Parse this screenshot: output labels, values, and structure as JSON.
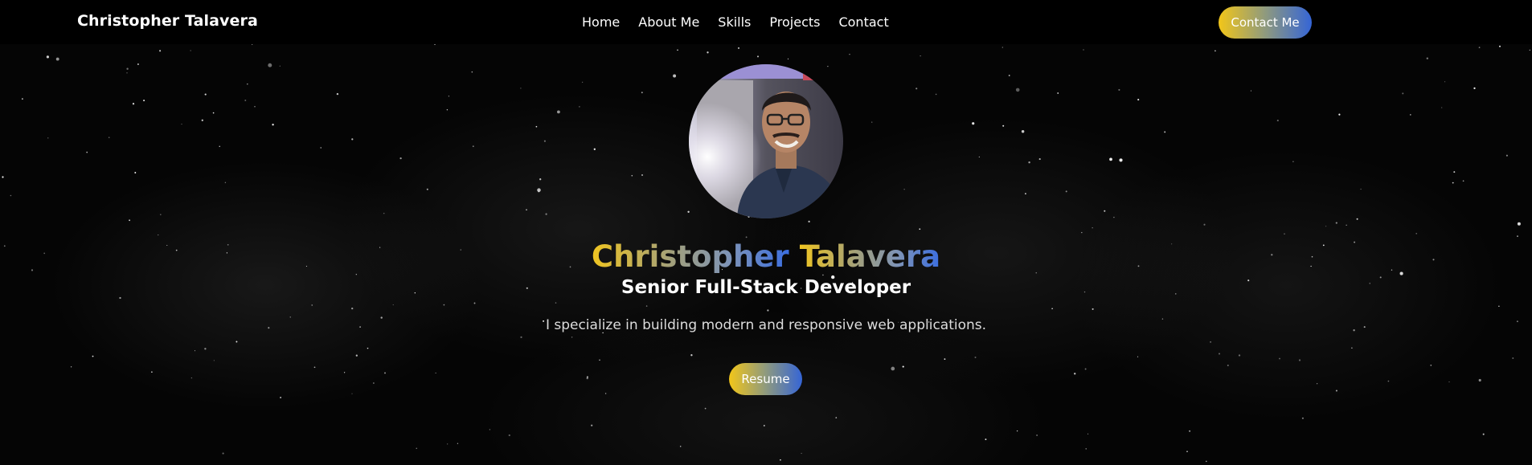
{
  "navbar": {
    "brand": "Christopher Talavera",
    "links": [
      {
        "label": "Home"
      },
      {
        "label": "About Me"
      },
      {
        "label": "Skills"
      },
      {
        "label": "Projects"
      },
      {
        "label": "Contact"
      }
    ],
    "contact_button": "Contact Me"
  },
  "hero": {
    "avatar_icon": "profile-photo",
    "name_first": "Christopher",
    "name_last": "Talavera",
    "role": "Senior Full-Stack Developer",
    "tagline": "I specialize in building modern and responsive web applications.",
    "resume_button": "Resume"
  },
  "colors": {
    "background": "#000000",
    "gradient_start": "#f2c619",
    "gradient_end": "#3565d6",
    "text": "#ffffff"
  }
}
